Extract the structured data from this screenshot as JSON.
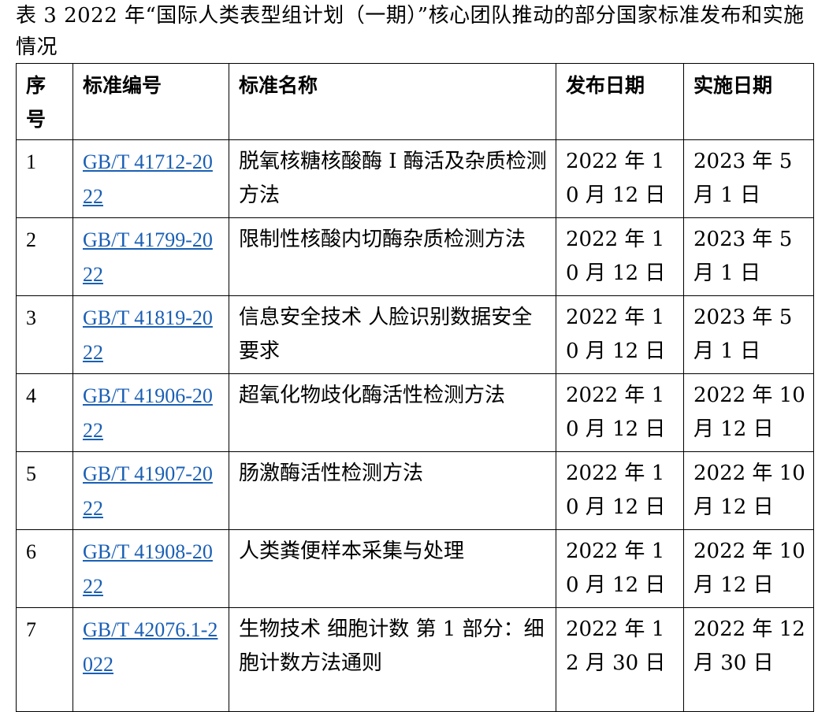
{
  "caption": "表 3 2022 年“国际人类表型组计划（一期）”核心团队推动的部分国家标准发布和实施情况",
  "table": {
    "headers": {
      "seq": "序号",
      "code": "标准编号",
      "name": "标准名称",
      "release": "发布日期",
      "implement": "实施日期"
    },
    "rows": [
      {
        "seq": "1",
        "code": "GB/T 41712-2022",
        "name": "脱氧核糖核酸酶 I 酶活及杂质检测方法",
        "release": "2022 年 10 月 12 日",
        "implement": "2023 年 5 月 1 日"
      },
      {
        "seq": "2",
        "code": "GB/T 41799-2022",
        "name": "限制性核酸内切酶杂质检测方法",
        "release": "2022 年 10 月 12 日",
        "implement": "2023 年 5 月 1 日"
      },
      {
        "seq": "3",
        "code": "GB/T 41819-2022",
        "name": "信息安全技术 人脸识别数据安全要求",
        "release": "2022 年 10 月 12 日",
        "implement": "2023 年 5 月 1 日"
      },
      {
        "seq": "4",
        "code": "GB/T 41906-2022",
        "name": "超氧化物歧化酶活性检测方法",
        "release": "2022 年 10 月 12 日",
        "implement": "2022 年 10 月 12 日"
      },
      {
        "seq": "5",
        "code": "GB/T 41907-2022",
        "name": "肠激酶活性检测方法",
        "release": "2022 年 10 月 12 日",
        "implement": "2022 年 10 月 12 日"
      },
      {
        "seq": "6",
        "code": "GB/T 41908-2022",
        "name": "人类粪便样本采集与处理",
        "release": "2022 年 10 月 12 日",
        "implement": "2022 年 10 月 12 日"
      },
      {
        "seq": "7",
        "code": "GB/T 42076.1-2022",
        "name": "生物技术 细胞计数 第 1 部分：细胞计数方法通则",
        "release": "2022 年 12 月 30 日",
        "implement": "2022 年 12 月 30 日"
      }
    ]
  },
  "colors": {
    "link": "#1a5fb4",
    "border": "#000000",
    "text": "#000000",
    "background": "#ffffff"
  }
}
